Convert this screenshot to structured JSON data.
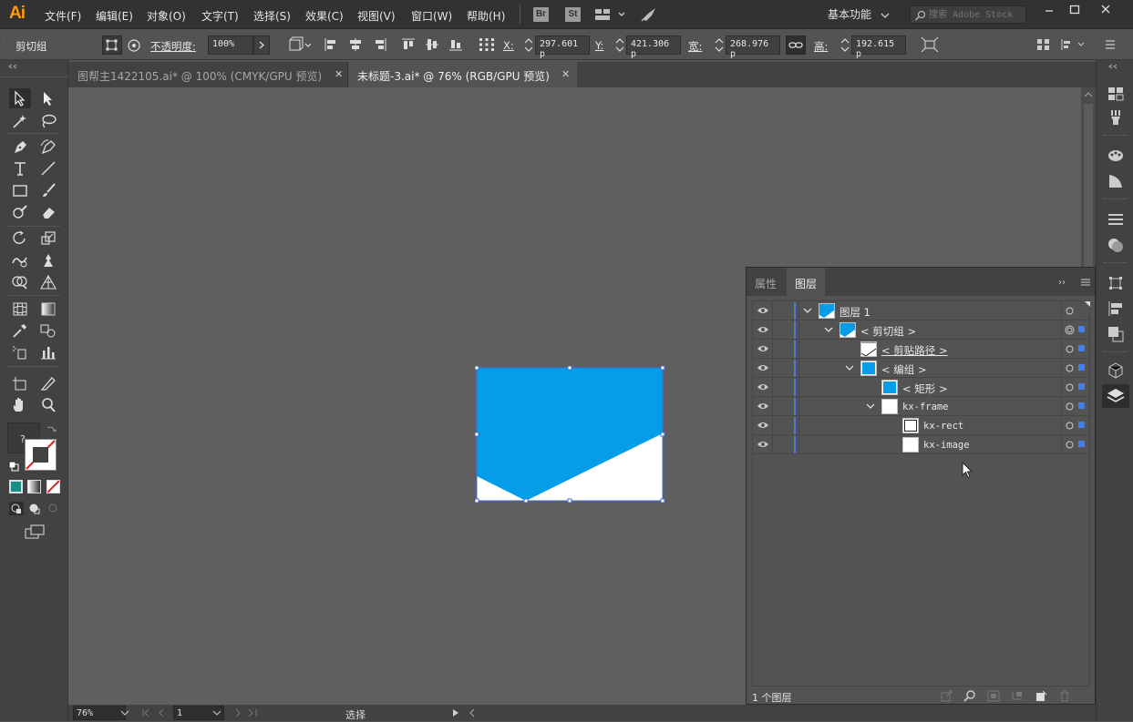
{
  "app": {
    "logo": "Ai",
    "menus": [
      "文件(F)",
      "编辑(E)",
      "对象(O)",
      "文字(T)",
      "选择(S)",
      "效果(C)",
      "视图(V)",
      "窗口(W)",
      "帮助(H)"
    ],
    "bridge_label": "Br",
    "stock_label": "St",
    "workspace_label": "基本功能",
    "search_placeholder": "搜索 Adobe Stock"
  },
  "control_bar": {
    "selection_label": "剪切组",
    "opacity_label": "不透明度:",
    "opacity_value": "100%",
    "x_label": "X:",
    "x_value": "297.601 p",
    "y_label": "Y:",
    "y_value": "421.306 p",
    "w_label": "宽:",
    "w_value": "268.976 p",
    "h_label": "高:",
    "h_value": "192.615 p"
  },
  "tabs": [
    {
      "label": "图帮主1422105.ai* @ 100% (CMYK/GPU 预览)",
      "active": false
    },
    {
      "label": "未标题-3.ai* @ 76% (RGB/GPU 预览)",
      "active": true
    }
  ],
  "status_bar": {
    "zoom": "76%",
    "page": "1",
    "status": "选择"
  },
  "artwork": {
    "fill_color": "#049DE8",
    "background_color": "#FFFFFF",
    "selection_color": "#3F6FD8"
  },
  "layers_panel": {
    "tabs": [
      "属性",
      "图层"
    ],
    "active_tab": "图层",
    "rows": [
      {
        "name": "图层 1",
        "depth": 0,
        "expanded": true,
        "thumb": "artwork"
      },
      {
        "name": "< 剪切组 >",
        "depth": 1,
        "expanded": true,
        "thumb": "artwork"
      },
      {
        "name": "< 剪贴路径 >",
        "depth": 2,
        "expanded": null,
        "thumb": "path"
      },
      {
        "name": "< 编组 >",
        "depth": 2,
        "expanded": true,
        "thumb": "blue"
      },
      {
        "name": "< 矩形 >",
        "depth": 3,
        "expanded": null,
        "thumb": "blue"
      },
      {
        "name": "kx-frame",
        "depth": 3,
        "expanded": true,
        "thumb": "white"
      },
      {
        "name": "kx-rect",
        "depth": 4,
        "expanded": null,
        "thumb": "rect"
      },
      {
        "name": "kx-image",
        "depth": 4,
        "expanded": null,
        "thumb": "white"
      }
    ],
    "layer_count": "1 个图层"
  }
}
